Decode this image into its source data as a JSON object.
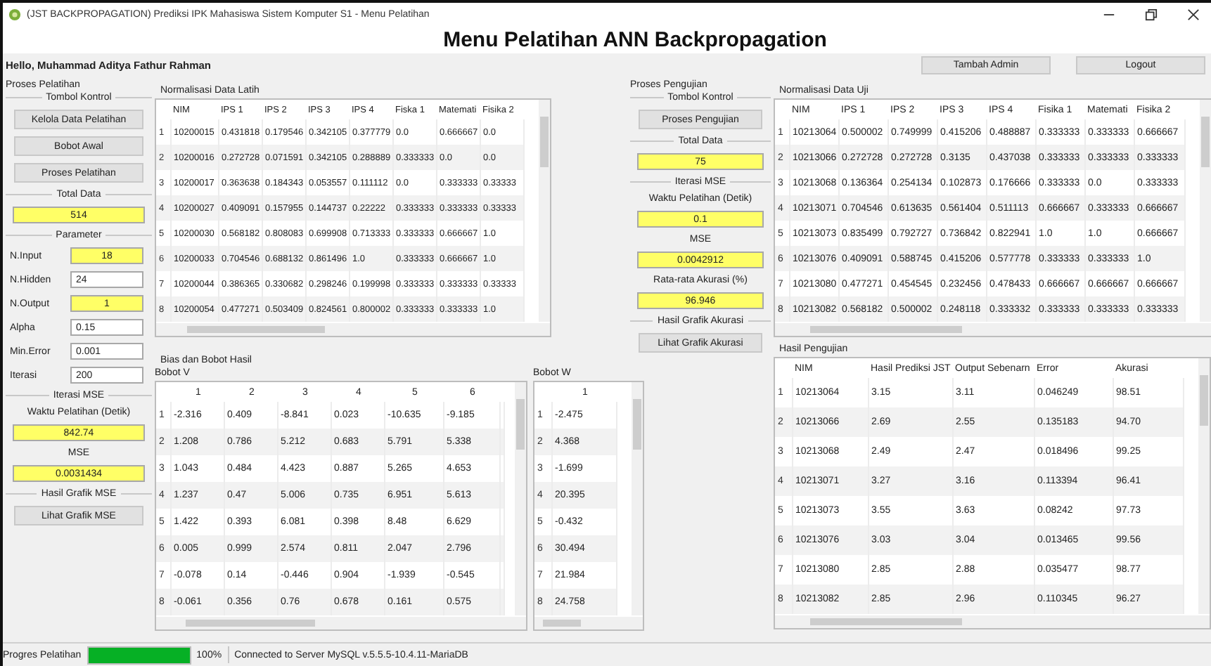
{
  "window": {
    "title": "(JST BACKPROPAGATION) Prediksi IPK Mahasiswa Sistem Komputer S1 - Menu Pelatihan"
  },
  "heading": "Menu Pelatihan ANN Backpropagation",
  "greeting": "Hello, Muhammad Aditya Fathur Rahman",
  "header_buttons": [
    "Tambah Admin",
    "Logout"
  ],
  "panels": [
    {
      "title": "Proses Pelatihan",
      "items": [
        {
          "kind": "section",
          "text": "Tombol Kontrol"
        },
        {
          "kind": "button",
          "text": "Kelola Data Pelatihan"
        },
        {
          "kind": "button",
          "text": "Bobot Awal"
        },
        {
          "kind": "button",
          "text": "Proses Pelatihan"
        },
        {
          "kind": "section",
          "text": "Total Data"
        },
        {
          "kind": "output",
          "value": "514",
          "readonly": true
        },
        {
          "kind": "section",
          "text": "Parameter"
        },
        {
          "kind": "param",
          "label": "N.Input",
          "value": "18",
          "readonly": true
        },
        {
          "kind": "param",
          "label": "N.Hidden",
          "value": "24",
          "readonly": false
        },
        {
          "kind": "param",
          "label": "N.Output",
          "value": "1",
          "readonly": true
        },
        {
          "kind": "param",
          "label": "Alpha",
          "value": "0.15",
          "readonly": false
        },
        {
          "kind": "param",
          "label": "Min.Error",
          "value": "0.001",
          "readonly": false
        },
        {
          "kind": "param",
          "label": "Iterasi",
          "value": "200",
          "readonly": false
        },
        {
          "kind": "section",
          "text": "Iterasi  MSE"
        },
        {
          "kind": "caption",
          "text": "Waktu Pelatihan (Detik)"
        },
        {
          "kind": "output",
          "value": "842.74",
          "readonly": true
        },
        {
          "kind": "caption",
          "text": "MSE"
        },
        {
          "kind": "output",
          "value": "0.0031434",
          "readonly": true
        },
        {
          "kind": "section",
          "text": "Hasil Grafik MSE"
        },
        {
          "kind": "button",
          "text": "Lihat Grafik MSE"
        }
      ]
    },
    {
      "title": "Proses Pengujian",
      "items": [
        {
          "kind": "section",
          "text": "Tombol Kontrol"
        },
        {
          "kind": "button",
          "text": "Proses Pengujian"
        },
        {
          "kind": "section",
          "text": "Total Data"
        },
        {
          "kind": "output",
          "value": "75",
          "readonly": true
        },
        {
          "kind": "section",
          "text": "Iterasi  MSE"
        },
        {
          "kind": "caption",
          "text": "Waktu Pelatihan (Detik)"
        },
        {
          "kind": "output",
          "value": "0.1",
          "readonly": true
        },
        {
          "kind": "caption",
          "text": "MSE"
        },
        {
          "kind": "output",
          "value": "0.0042912",
          "readonly": true
        },
        {
          "kind": "caption",
          "text": "Rata-rata Akurasi (%)"
        },
        {
          "kind": "output",
          "value": "96.946",
          "readonly": true
        },
        {
          "kind": "section",
          "text": "Hasil Grafik Akurasi"
        },
        {
          "kind": "button",
          "text": "Lihat Grafik Akurasi"
        }
      ]
    }
  ],
  "training_data": {
    "title": "Normalisasi Data Latih",
    "columns": [
      "NIM",
      "IPS 1",
      "IPS 2",
      "IPS 3",
      "IPS 4",
      "Fiska 1",
      "Matemati",
      "Fisika 2"
    ],
    "row_numbers": [
      "1",
      "2",
      "3",
      "4",
      "5",
      "6",
      "7",
      "8"
    ],
    "rows": [
      [
        "10200015",
        "0.431818",
        "0.179546",
        "0.342105",
        "0.377779",
        "0.0",
        "0.666667",
        "0.0"
      ],
      [
        "10200016",
        "0.272728",
        "0.071591",
        "0.342105",
        "0.288889",
        "0.333333",
        "0.0",
        "0.0"
      ],
      [
        "10200017",
        "0.363638",
        "0.184343",
        "0.053557",
        "0.111112",
        "0.0",
        "0.333333",
        "0.33333"
      ],
      [
        "10200027",
        "0.409091",
        "0.157955",
        "0.144737",
        "0.22222",
        "0.333333",
        "0.333333",
        "0.33333"
      ],
      [
        "10200030",
        "0.568182",
        "0.808083",
        "0.699908",
        "0.713333",
        "0.333333",
        "0.666667",
        "1.0"
      ],
      [
        "10200033",
        "0.704546",
        "0.688132",
        "0.861496",
        "1.0",
        "0.333333",
        "0.666667",
        "1.0"
      ],
      [
        "10200044",
        "0.386365",
        "0.330682",
        "0.298246",
        "0.199998",
        "0.333333",
        "0.333333",
        "0.33333"
      ],
      [
        "10200054",
        "0.477271",
        "0.503409",
        "0.824561",
        "0.800002",
        "0.333333",
        "0.333333",
        "1.0"
      ]
    ]
  },
  "weights": {
    "title": "Bias dan Bobot Hasil",
    "tables": [
      {
        "label": "Bobot V",
        "columns": [
          "1",
          "2",
          "3",
          "4",
          "5",
          "6"
        ],
        "row_numbers": [
          "1",
          "2",
          "3",
          "4",
          "5",
          "6",
          "7",
          "8"
        ],
        "rows": [
          [
            "-2.316",
            "0.409",
            "-8.841",
            "0.023",
            "-10.635",
            "-9.185"
          ],
          [
            "1.208",
            "0.786",
            "5.212",
            "0.683",
            "5.791",
            "5.338"
          ],
          [
            "1.043",
            "0.484",
            "4.423",
            "0.887",
            "5.265",
            "4.653"
          ],
          [
            "1.237",
            "0.47",
            "5.006",
            "0.735",
            "6.951",
            "5.613"
          ],
          [
            "1.422",
            "0.393",
            "6.081",
            "0.398",
            "8.48",
            "6.629"
          ],
          [
            "0.005",
            "0.999",
            "2.574",
            "0.811",
            "2.047",
            "2.796"
          ],
          [
            "-0.078",
            "0.14",
            "-0.446",
            "0.904",
            "-1.939",
            "-0.545"
          ],
          [
            "-0.061",
            "0.356",
            "0.76",
            "0.678",
            "0.161",
            "0.575"
          ]
        ]
      },
      {
        "label": "Bobot W",
        "columns": [
          "1"
        ],
        "row_numbers": [
          "1",
          "2",
          "3",
          "4",
          "5",
          "6",
          "7",
          "8"
        ],
        "rows": [
          [
            "-2.475"
          ],
          [
            "4.368"
          ],
          [
            "-1.699"
          ],
          [
            "20.395"
          ],
          [
            "-0.432"
          ],
          [
            "30.494"
          ],
          [
            "21.984"
          ],
          [
            "24.758"
          ]
        ]
      }
    ]
  },
  "test_data": {
    "title": "Normalisasi Data Uji",
    "columns": [
      "NIM",
      "IPS 1",
      "IPS 2",
      "IPS 3",
      "IPS 4",
      "Fisika 1",
      "Matemati",
      "Fisika 2"
    ],
    "row_numbers": [
      "1",
      "2",
      "3",
      "4",
      "5",
      "6",
      "7",
      "8"
    ],
    "rows": [
      [
        "10213064",
        "0.500002",
        "0.749999",
        "0.415206",
        "0.488887",
        "0.333333",
        "0.333333",
        "0.666667"
      ],
      [
        "10213066",
        "0.272728",
        "0.272728",
        "0.3135",
        "0.437038",
        "0.333333",
        "0.333333",
        "0.333333"
      ],
      [
        "10213068",
        "0.136364",
        "0.254134",
        "0.102873",
        "0.176666",
        "0.333333",
        "0.0",
        "0.333333"
      ],
      [
        "10213071",
        "0.704546",
        "0.613635",
        "0.561404",
        "0.511113",
        "0.666667",
        "0.333333",
        "0.666667"
      ],
      [
        "10213073",
        "0.835499",
        "0.792727",
        "0.736842",
        "0.822941",
        "1.0",
        "1.0",
        "0.666667"
      ],
      [
        "10213076",
        "0.409091",
        "0.588745",
        "0.415206",
        "0.577778",
        "0.333333",
        "0.333333",
        "1.0"
      ],
      [
        "10213080",
        "0.477271",
        "0.454545",
        "0.232456",
        "0.478433",
        "0.666667",
        "0.666667",
        "0.666667"
      ],
      [
        "10213082",
        "0.568182",
        "0.500002",
        "0.248118",
        "0.333332",
        "0.333333",
        "0.333333",
        "0.333333"
      ]
    ]
  },
  "test_results": {
    "title": "Hasil Pengujian",
    "columns": [
      "NIM",
      "Hasil Prediksi JST",
      "Output Sebenarn",
      "Error",
      "Akurasi"
    ],
    "row_numbers": [
      "1",
      "2",
      "3",
      "4",
      "5",
      "6",
      "7",
      "8"
    ],
    "rows": [
      [
        "10213064",
        "3.15",
        "3.11",
        "0.046249",
        "98.51"
      ],
      [
        "10213066",
        "2.69",
        "2.55",
        "0.135183",
        "94.70"
      ],
      [
        "10213068",
        "2.49",
        "2.47",
        "0.018496",
        "99.25"
      ],
      [
        "10213071",
        "3.27",
        "3.16",
        "0.113394",
        "96.41"
      ],
      [
        "10213073",
        "3.55",
        "3.63",
        "0.08242",
        "97.73"
      ],
      [
        "10213076",
        "3.03",
        "3.04",
        "0.013465",
        "99.56"
      ],
      [
        "10213080",
        "2.85",
        "2.88",
        "0.035477",
        "98.77"
      ],
      [
        "10213082",
        "2.85",
        "2.96",
        "0.110345",
        "96.27"
      ]
    ]
  },
  "status_bar": {
    "label": "Progres Pelatihan",
    "level": 1.0,
    "percent": "100%",
    "message": "Connected to Server MySQL v.5.5.5-10.4.11-MariaDB"
  }
}
